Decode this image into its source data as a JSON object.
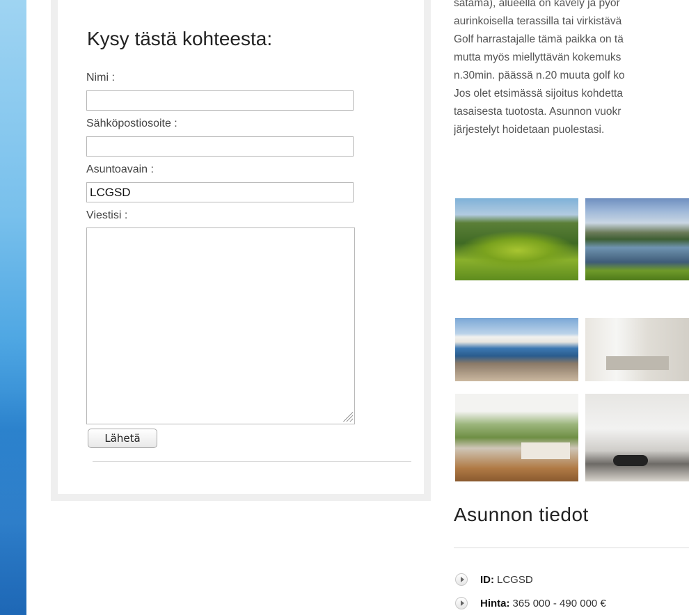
{
  "form": {
    "title": "Kysy tästä kohteesta:",
    "name_label": "Nimi :",
    "name_value": "",
    "email_label": "Sähköpostiosoite :",
    "email_value": "",
    "key_label": "Asuntoavain :",
    "key_value": "LCGSD",
    "message_label": "Viestisi :",
    "message_value": "",
    "submit_label": "Lähetä"
  },
  "description": {
    "lines": [
      "satama), alueella on kävely ja pyör",
      "aurinkoisella terassilla tai virkistävä",
      "Golf harrastajalle tämä paikka on tä",
      "mutta myös miellyttävän kokemuks",
      "n.30min. päässä n.20 muuta golf ko",
      "Jos olet etsimässä sijoitus kohdetta",
      "tasaisesta tuotosta. Asunnon vuokr",
      "järjestelyt hoidetaan puolestasi."
    ]
  },
  "details": {
    "title": "Asunnon tiedot",
    "items": [
      {
        "label": "ID:",
        "value": "LCGSD"
      },
      {
        "label": "Hinta:",
        "value": "365 000 - 490 000 €"
      }
    ]
  }
}
